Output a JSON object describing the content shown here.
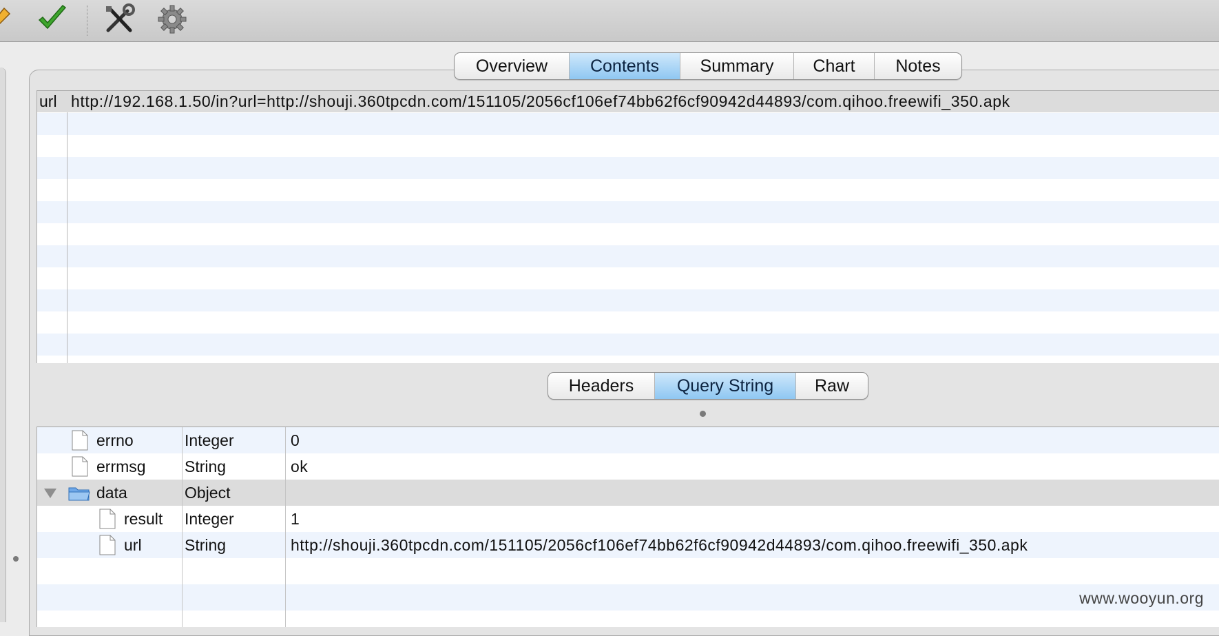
{
  "toolbar": {
    "icons": [
      "pencil-icon",
      "checkmark-icon",
      "tools-icon",
      "gear-icon"
    ]
  },
  "top_tabs": [
    {
      "label": "Overview",
      "active": false
    },
    {
      "label": "Contents",
      "active": true
    },
    {
      "label": "Summary",
      "active": false
    },
    {
      "label": "Chart",
      "active": false
    },
    {
      "label": "Notes",
      "active": false
    }
  ],
  "url_row": {
    "key": "url",
    "value": "http://192.168.1.50/in?url=http://shouji.360tpcdn.com/151105/2056cf106ef74bb62f6cf90942d44893/com.qihoo.freewifi_350.apk"
  },
  "bottom_tabs": [
    {
      "label": "Headers",
      "active": false
    },
    {
      "label": "Query String",
      "active": true
    },
    {
      "label": "Raw",
      "active": false
    }
  ],
  "tree": {
    "rows": [
      {
        "name": "errno",
        "type": "Integer",
        "value": "0"
      },
      {
        "name": "errmsg",
        "type": "String",
        "value": "ok"
      },
      {
        "name": "data",
        "type": "Object",
        "value": ""
      },
      {
        "name": "result",
        "type": "Integer",
        "value": "1"
      },
      {
        "name": "url",
        "type": "String",
        "value": "http://shouji.360tpcdn.com/151105/2056cf106ef74bb62f6cf90942d44893/com.qihoo.freewifi_350.apk"
      }
    ]
  },
  "watermark": "www.wooyun.org",
  "colors": {
    "active_tab": "#8fc7f2",
    "row_alt": "#eef4fd",
    "row_selected": "#dcdcdc"
  }
}
